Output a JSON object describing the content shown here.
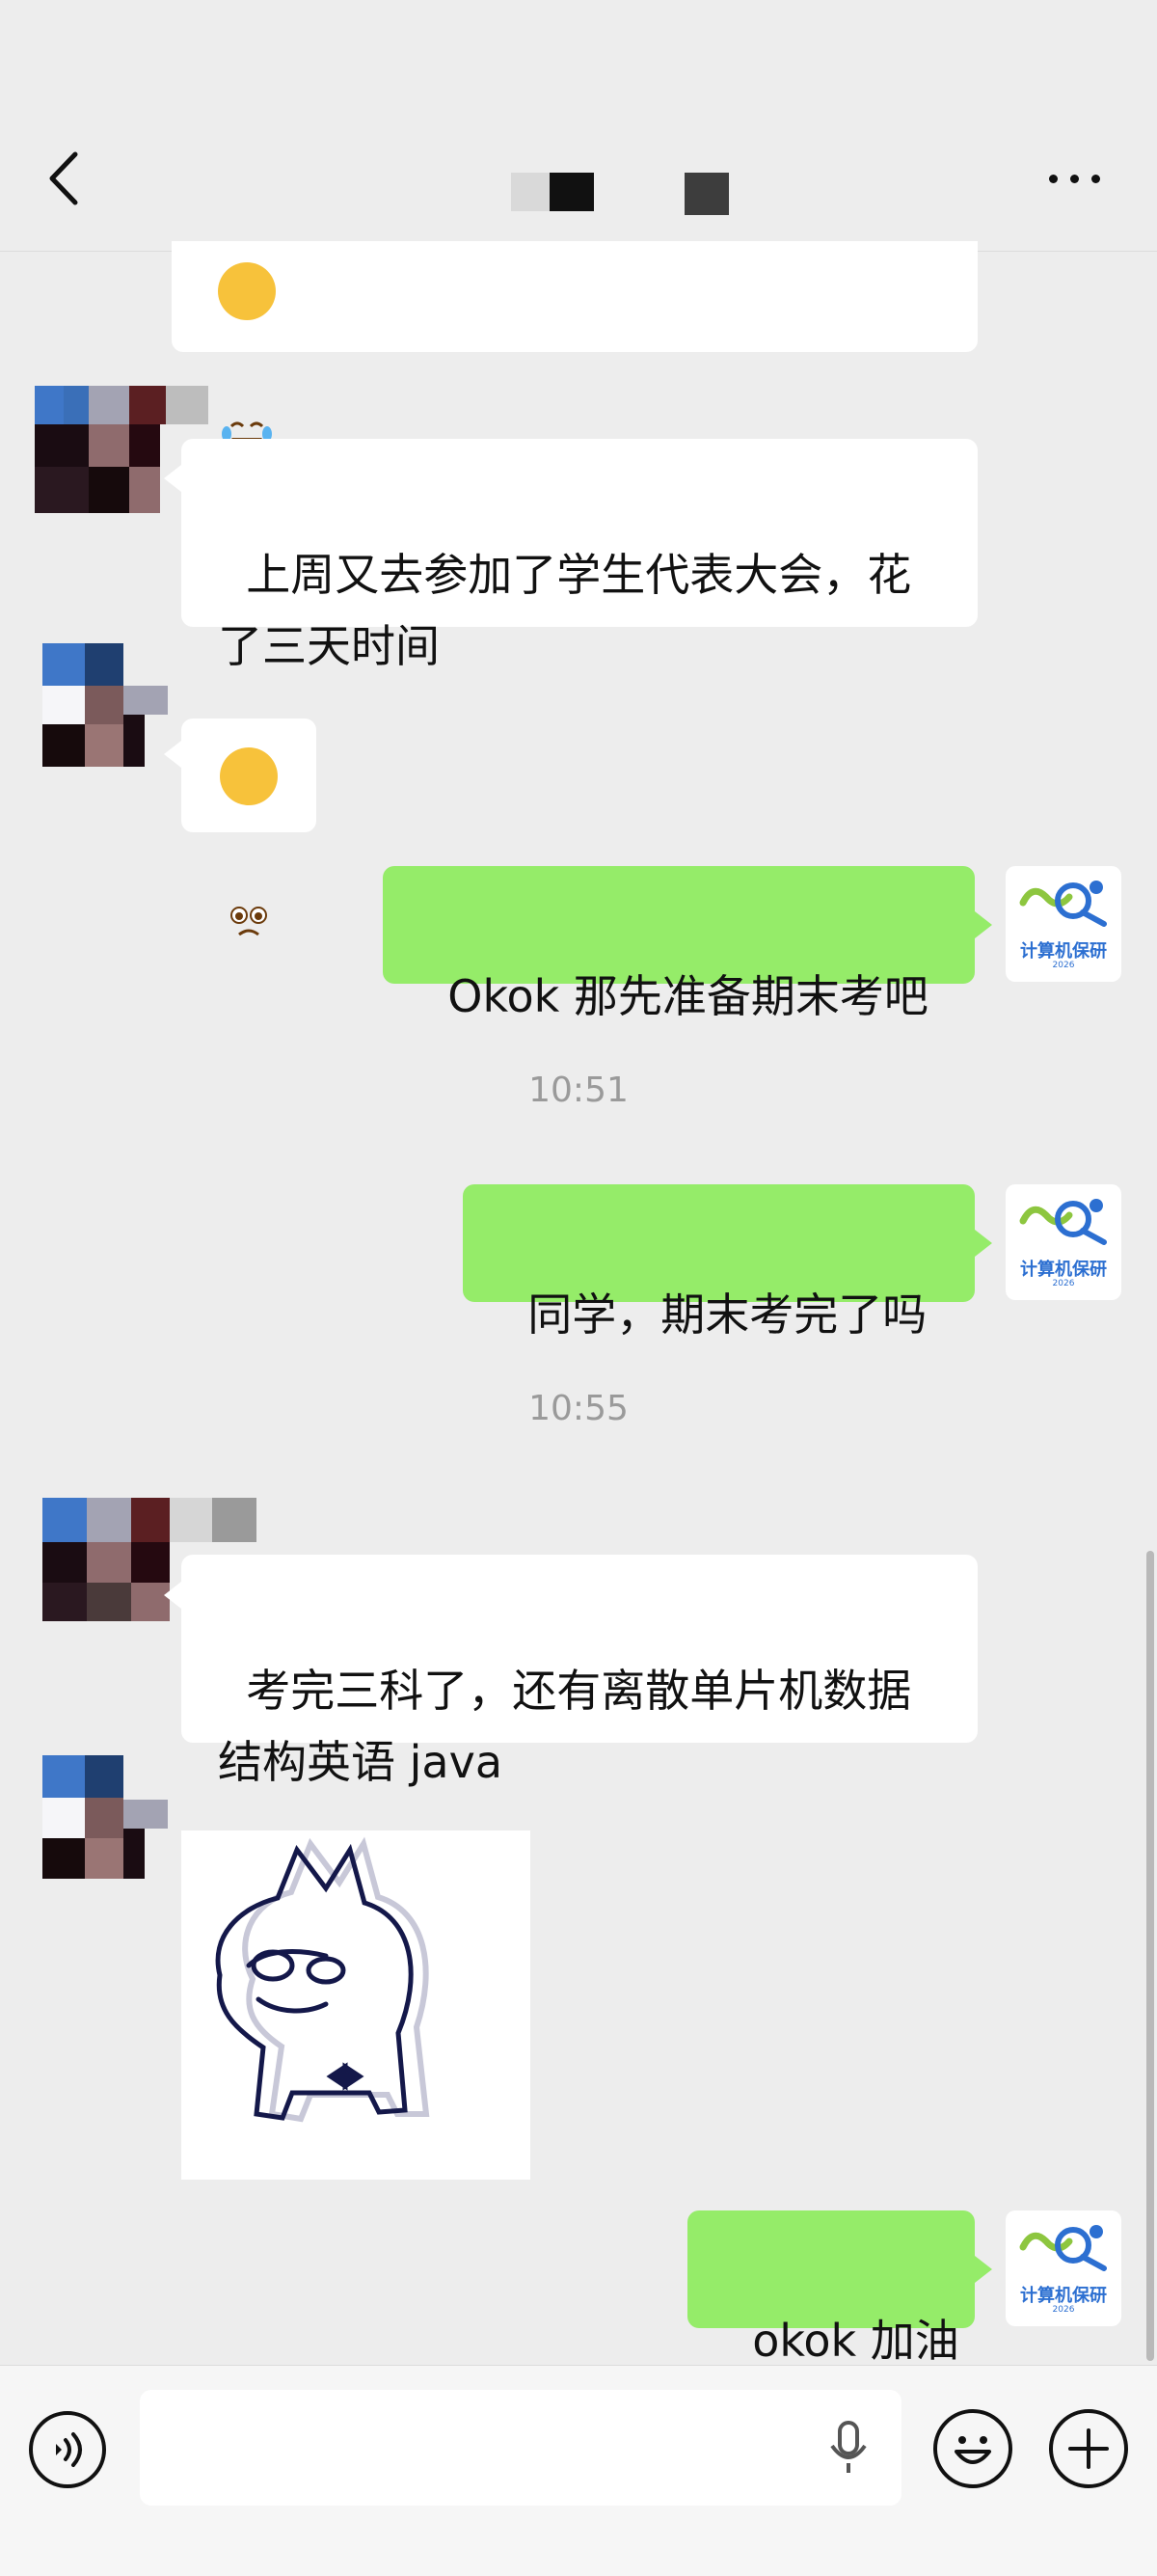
{
  "header": {
    "back_icon": "chevron-left-icon",
    "more_icon": "more-dots-icon",
    "title_pixel_colors": [
      "#d9d9d9",
      "#111111",
      "#3d3d3d"
    ]
  },
  "messages": [
    {
      "id": "m0",
      "side": "in",
      "type": "emoji",
      "emoji": "laughing-crying-face"
    },
    {
      "id": "m1",
      "side": "in",
      "type": "text",
      "text": "上周又去参加了学生代表大会，花\n了三天时间"
    },
    {
      "id": "m2",
      "side": "in",
      "type": "emoji",
      "emoji": "pleading-face"
    },
    {
      "id": "m3",
      "side": "out",
      "type": "text",
      "text": "Okok 那先准备期末考吧"
    },
    {
      "id": "t1",
      "type": "time",
      "text": "10:51"
    },
    {
      "id": "m4",
      "side": "out",
      "type": "text",
      "text": "同学，期末考完了吗"
    },
    {
      "id": "t2",
      "type": "time",
      "text": "10:55"
    },
    {
      "id": "m5",
      "side": "in",
      "type": "text",
      "text": "考完三科了，还有离散单片机数据\n结构英语 java"
    },
    {
      "id": "m6",
      "side": "in",
      "type": "sticker",
      "sticker": "cat-doodle-sticker"
    },
    {
      "id": "m7",
      "side": "out",
      "type": "text",
      "text": "okok 加油"
    }
  ],
  "my_avatar": {
    "logo_text": "计算机保研",
    "logo_sub": "2026",
    "accent_green": "#8dc63f",
    "accent_blue": "#2c6fd1"
  },
  "colors": {
    "background": "#ededed",
    "bubble_out": "#95ec69",
    "bubble_in": "#ffffff"
  },
  "input_bar": {
    "voice_icon": "voice-mode-icon",
    "text_value": "",
    "mic_icon": "microphone-icon",
    "emoji_icon": "emoji-icon",
    "plus_icon": "plus-icon"
  }
}
